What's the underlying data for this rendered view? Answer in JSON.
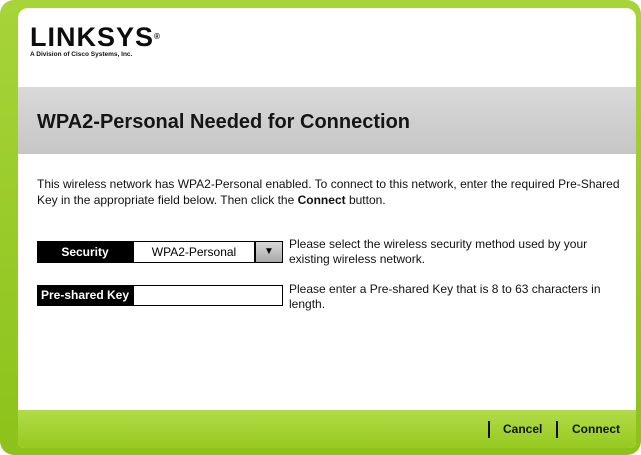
{
  "brand": {
    "name": "LINKSYS",
    "trademark": "®",
    "tagline": "A Division of Cisco Systems, Inc."
  },
  "page": {
    "title": "WPA2-Personal Needed for Connection",
    "description_pre": "This wireless network has WPA2-Personal enabled. To connect to this network, enter the required Pre-Shared Key in the appropriate field below. Then click the ",
    "description_bold": "Connect",
    "description_post": " button."
  },
  "security": {
    "label": "Security",
    "value": "WPA2-Personal",
    "dropdown_glyph": "▼",
    "help": "Please select the wireless security method used by your existing wireless network."
  },
  "preshared_key": {
    "label": "Pre-shared Key",
    "value": "",
    "help": "Please enter a Pre-shared Key that is 8 to 63 characters in length."
  },
  "footer": {
    "cancel_label": "Cancel",
    "connect_label": "Connect"
  },
  "colors": {
    "frame_green": "#8cc21a",
    "title_band_gray": "#cccccc",
    "label_black": "#000000"
  }
}
